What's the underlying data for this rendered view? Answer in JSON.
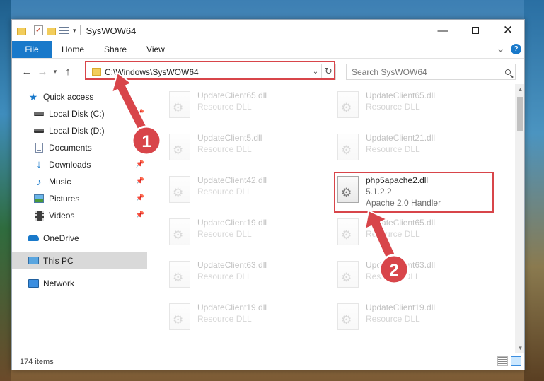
{
  "window": {
    "title": "SysWOW64",
    "controls": {
      "minimize": "—",
      "maximize": "",
      "close": "✕"
    }
  },
  "ribbon": {
    "tabs": [
      "File",
      "Home",
      "Share",
      "View"
    ],
    "help": "?"
  },
  "navigation": {
    "back": "←",
    "forward": "→",
    "recent": "▾",
    "up": "↑",
    "address_path": "C:\\Windows\\SysWOW64",
    "refresh": "↻",
    "search_placeholder": "Search SysWOW64"
  },
  "sidebar": {
    "items": [
      {
        "label": "Quick access",
        "icon": "star-icon"
      },
      {
        "label": "Local Disk (C:)",
        "icon": "drive-icon",
        "pinned": true
      },
      {
        "label": "Local Disk (D:)",
        "icon": "drive-icon"
      },
      {
        "label": "Documents",
        "icon": "documents-icon",
        "pinned": true
      },
      {
        "label": "Downloads",
        "icon": "download-icon",
        "pinned": true
      },
      {
        "label": "Music",
        "icon": "music-icon",
        "pinned": true
      },
      {
        "label": "Pictures",
        "icon": "pictures-icon",
        "pinned": true
      },
      {
        "label": "Videos",
        "icon": "videos-icon",
        "pinned": true
      },
      {
        "label": "OneDrive",
        "icon": "onedrive-icon"
      },
      {
        "label": "This PC",
        "icon": "computer-icon",
        "selected": true
      },
      {
        "label": "Network",
        "icon": "network-icon"
      }
    ],
    "pin_glyph": "📌"
  },
  "files": [
    {
      "name": "UpdateClient65.dll",
      "desc": "Resource DLL"
    },
    {
      "name": "UpdateClient65.dll",
      "desc": "Resource DLL"
    },
    {
      "name": "UpdateClient5.dll",
      "desc": "Resource DLL"
    },
    {
      "name": "UpdateClient21.dll",
      "desc": "Resource DLL"
    },
    {
      "name": "UpdateClient42.dll",
      "desc": "Resource DLL"
    },
    {
      "name": "php5apache2.dll",
      "version": "5.1.2.2",
      "desc": "Apache 2.0 Handler",
      "highlighted": true
    },
    {
      "name": "UpdateClient19.dll",
      "desc": "Resource DLL"
    },
    {
      "name": "UpdateClient65.dll",
      "desc": "Resource DLL"
    },
    {
      "name": "UpdateClient63.dll",
      "desc": "Resource DLL"
    },
    {
      "name": "UpdateClient63.dll",
      "desc": "Resource DLL"
    },
    {
      "name": "UpdateClient19.dll",
      "desc": "Resource DLL"
    },
    {
      "name": "UpdateClient19.dll",
      "desc": "Resource DLL"
    }
  ],
  "status": {
    "item_count": "174 items"
  },
  "annotations": {
    "step1": "1",
    "step2": "2",
    "color": "#d8454a"
  }
}
